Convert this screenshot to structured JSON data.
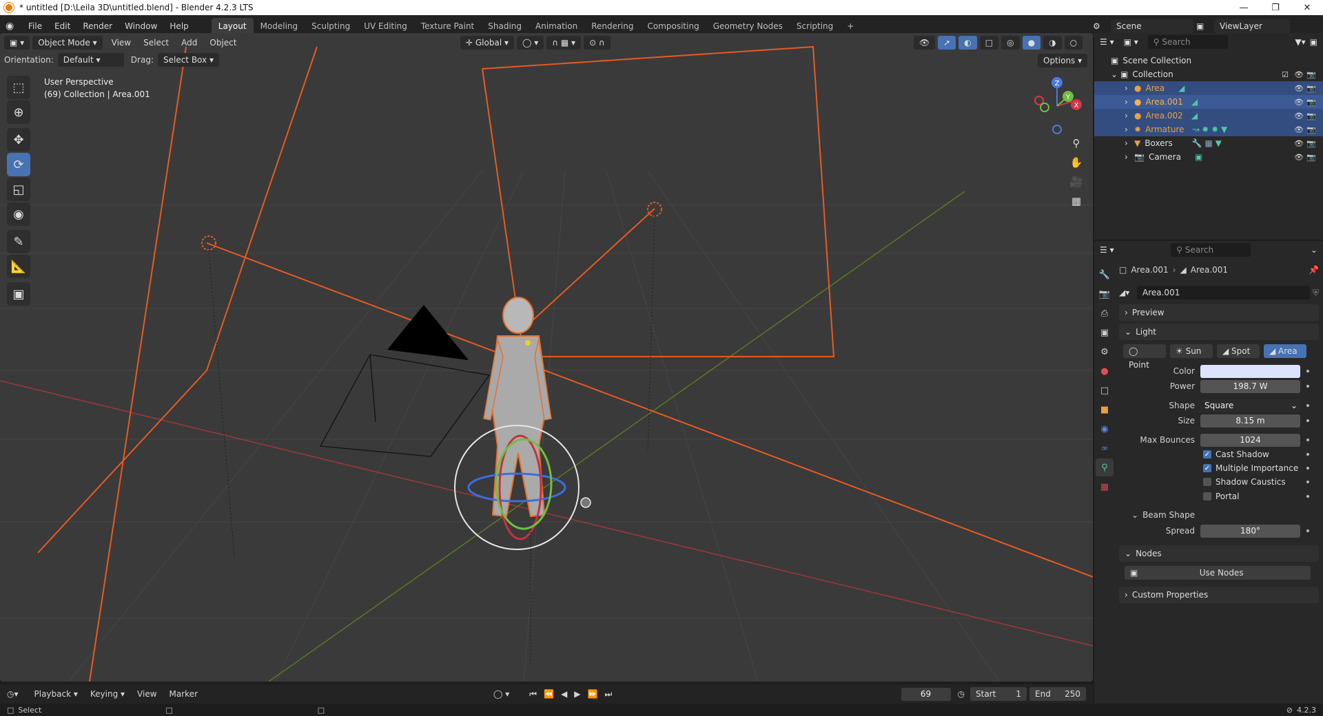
{
  "window": {
    "title": "* untitled [D:\\Leila 3D\\untitled.blend] - Blender 4.2.3 LTS"
  },
  "menu": {
    "items": [
      "File",
      "Edit",
      "Render",
      "Window",
      "Help"
    ]
  },
  "workspaces": [
    "Layout",
    "Modeling",
    "Sculpting",
    "UV Editing",
    "Texture Paint",
    "Shading",
    "Animation",
    "Rendering",
    "Compositing",
    "Geometry Nodes",
    "Scripting"
  ],
  "scene": {
    "label": "Scene",
    "view_layer": "ViewLayer"
  },
  "viewport": {
    "mode": "Object Mode",
    "menus": [
      "View",
      "Select",
      "Add",
      "Object"
    ],
    "transform": "Global",
    "orientation_label": "Orientation:",
    "orientation_value": "Default",
    "drag_label": "Drag:",
    "drag_value": "Select Box",
    "options": "Options",
    "overlay_title": "User Perspective",
    "overlay_sub": "(69) Collection | Area.001",
    "gizmo": {
      "z": "Z",
      "y": "Y",
      "x": "X"
    }
  },
  "outliner": {
    "search_placeholder": "Search",
    "root": "Scene Collection",
    "collection": "Collection",
    "items": [
      {
        "name": "Area",
        "color": "#e8a040"
      },
      {
        "name": "Area.001",
        "color": "#ffb04a"
      },
      {
        "name": "Area.002",
        "color": "#e8a040"
      },
      {
        "name": "Armature",
        "color": "#e8a040"
      },
      {
        "name": "Boxers",
        "color": "#dddddd"
      },
      {
        "name": "Camera",
        "color": "#dddddd"
      }
    ]
  },
  "properties": {
    "search_placeholder": "Search",
    "breadcrumb_object": "Area.001",
    "breadcrumb_data": "Area.001",
    "datablock": "Area.001",
    "preview": "Preview",
    "light": "Light",
    "light_types": [
      "Point",
      "Sun",
      "Spot",
      "Area"
    ],
    "color_label": "Color",
    "color_value": "#dde3ff",
    "power_label": "Power",
    "power_value": "198.7 W",
    "shape_label": "Shape",
    "shape_value": "Square",
    "size_label": "Size",
    "size_value": "8.15 m",
    "bounces_label": "Max Bounces",
    "bounces_value": "1024",
    "cast_shadow": "Cast Shadow",
    "multiple_importance": "Multiple Importance",
    "shadow_caustics": "Shadow Caustics",
    "portal": "Portal",
    "beam_shape": "Beam Shape",
    "spread_label": "Spread",
    "spread_value": "180°",
    "nodes": "Nodes",
    "use_nodes": "Use Nodes",
    "custom_props": "Custom Properties"
  },
  "timeline": {
    "menus": [
      "Playback",
      "Keying",
      "View",
      "Marker"
    ],
    "current_frame": "69",
    "start_label": "Start",
    "start_value": "1",
    "end_label": "End",
    "end_value": "250"
  },
  "status": {
    "left": "Select",
    "version": "4.2.3"
  }
}
